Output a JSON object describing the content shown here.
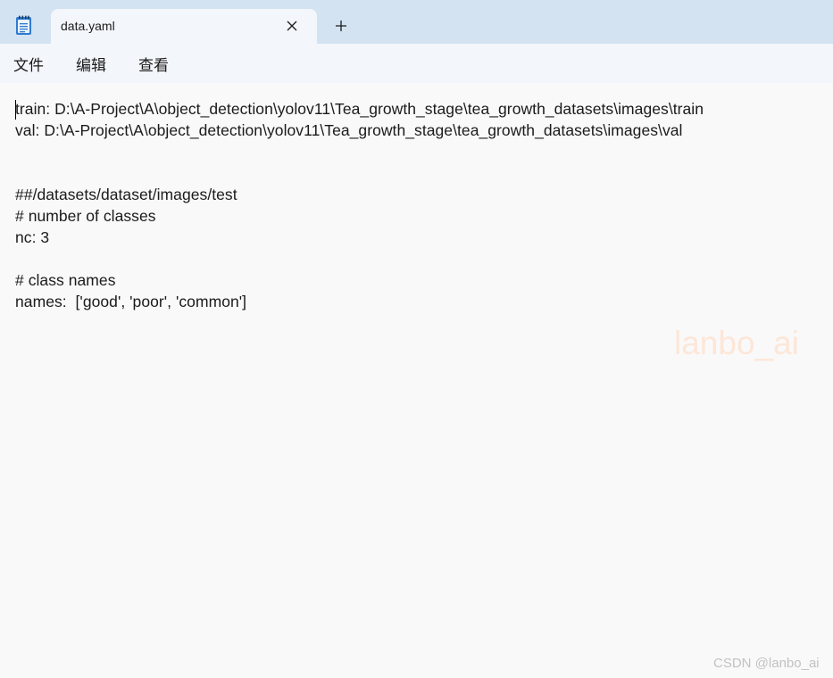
{
  "tab": {
    "title": "data.yaml",
    "icon": "notepad-icon",
    "close_icon": "close-icon",
    "new_tab_icon": "plus-icon"
  },
  "menu": {
    "items": [
      {
        "label": "文件"
      },
      {
        "label": "编辑"
      },
      {
        "label": "查看"
      }
    ]
  },
  "editor": {
    "lines": [
      "train: D:\\A-Project\\A\\object_detection\\yolov11\\Tea_growth_stage\\tea_growth_datasets\\images\\train",
      "val: D:\\A-Project\\A\\object_detection\\yolov11\\Tea_growth_stage\\tea_growth_datasets\\images\\val",
      "",
      "",
      "##/datasets/dataset/images/test",
      "# number of classes",
      "nc: 3",
      "",
      "# class names",
      "names:  ['good', 'poor', 'common']"
    ],
    "watermark": "lanbo_ai",
    "footer_watermark": "CSDN @lanbo_ai"
  },
  "colors": {
    "tabbar_bg": "#d3e3f1",
    "tab_bg": "#f3f6fa",
    "editor_bg": "#f9f9f9",
    "text": "#1b1b1b",
    "watermark": "#fde6d8"
  }
}
